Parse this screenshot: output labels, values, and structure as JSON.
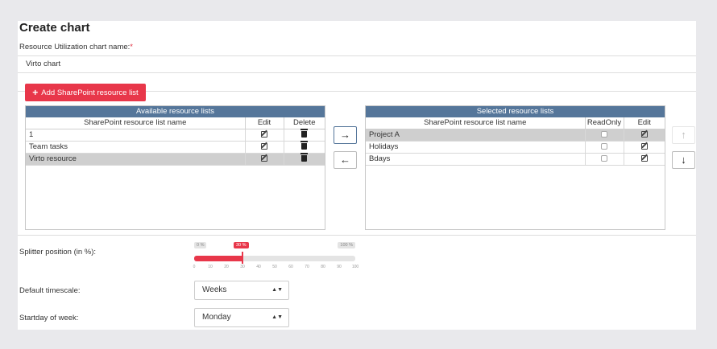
{
  "page": {
    "title": "Create chart",
    "chart_name_label": "Resource Utilization chart name:",
    "required_mark": "*",
    "chart_name_value": "Virto chart",
    "add_button_label": "Add SharePoint resource list"
  },
  "available": {
    "caption": "Available resource lists",
    "headers": {
      "name": "SharePoint resource list name",
      "edit": "Edit",
      "delete": "Delete"
    },
    "rows": [
      {
        "name": "1",
        "selected": false
      },
      {
        "name": "Team tasks",
        "selected": false
      },
      {
        "name": "Virto resource",
        "selected": true
      }
    ]
  },
  "selected": {
    "caption": "Selected resource lists",
    "headers": {
      "name": "SharePoint resource list name",
      "readonly": "ReadOnly",
      "edit": "Edit"
    },
    "rows": [
      {
        "name": "Project A",
        "selected": true
      },
      {
        "name": "Holidays",
        "selected": false
      },
      {
        "name": "Bdays",
        "selected": false
      }
    ]
  },
  "transfer": {
    "move_right_icon": "arrow-right-icon",
    "move_left_icon": "arrow-left-icon"
  },
  "order": {
    "up_icon": "arrow-up-icon",
    "down_icon": "arrow-down-icon"
  },
  "splitter": {
    "label": "Splitter position (in %):",
    "value": 30,
    "min_label": "0 %",
    "max_label": "100 %",
    "current_label": "30 %",
    "ticks": [
      "0",
      "10",
      "20",
      "30",
      "40",
      "50",
      "60",
      "70",
      "80",
      "90",
      "100"
    ]
  },
  "timescale": {
    "label": "Default timescale:",
    "value": "Weeks"
  },
  "startday": {
    "label": "Startday of week:",
    "value": "Monday"
  },
  "colors": {
    "accent": "#e8374a",
    "header": "#55769a",
    "selected_row": "#cfcfcf"
  }
}
